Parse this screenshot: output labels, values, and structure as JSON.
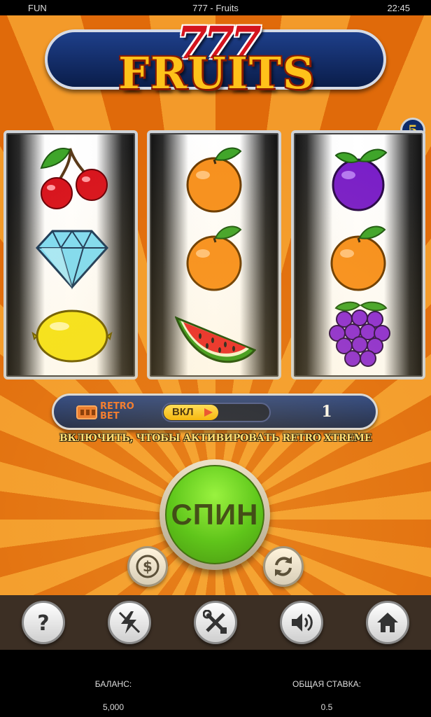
{
  "status_bar": {
    "left": "FUN",
    "title": "777 - Fruits",
    "time": "22:45"
  },
  "logo": {
    "top": "777",
    "title": "FRUITS"
  },
  "lines": "5",
  "reels": [
    [
      "cherry-icon",
      "diamond-icon",
      "lemon-icon"
    ],
    [
      "orange-icon",
      "orange-icon",
      "watermelon-icon"
    ],
    [
      "plum-icon",
      "orange-icon",
      "grapes-icon"
    ]
  ],
  "retro_bet": {
    "label_line1": "RETRO",
    "label_line2": "BET",
    "toggle_label": "ВКЛ",
    "bet_value": "1",
    "hint": "ВКЛЮЧИТЬ, ЧТОБЫ АКТИВИРОВАТЬ RETRO XTREME"
  },
  "spin": {
    "label": "СПИН"
  },
  "toolbar": {
    "items": [
      "help-icon",
      "lightning-icon",
      "settings-tools-icon",
      "sound-icon",
      "home-icon"
    ]
  },
  "footer": {
    "balance_label": "БАЛАНС:",
    "balance_value": "5,000",
    "bet_label": "ОБЩАЯ СТАВКА:",
    "bet_value": "0.5"
  },
  "colors": {
    "accent": "#f39a2a",
    "plate": "#0a1d4a",
    "spin": "#2fc40a",
    "gold": "#ffc21a"
  }
}
